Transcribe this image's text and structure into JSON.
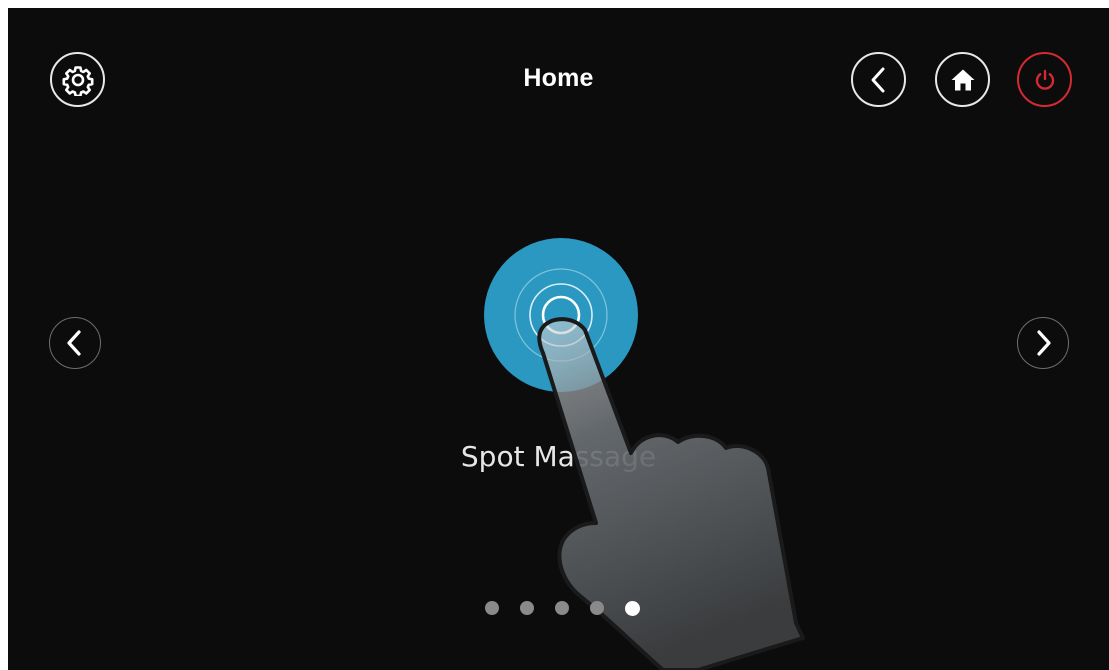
{
  "header": {
    "title": "Home",
    "settings_icon": "gear-icon",
    "back_icon": "chevron-left-icon",
    "home_icon": "home-icon",
    "power_icon": "power-icon"
  },
  "carousel": {
    "prev_icon": "chevron-left-icon",
    "next_icon": "chevron-right-icon",
    "feature": {
      "label": "Spot Massage",
      "icon": "ripple-target-icon",
      "color": "#2a98c0"
    },
    "page_count": 5,
    "active_page": 5
  },
  "overlay": {
    "icon": "tap-hand-icon"
  },
  "colors": {
    "background": "#0c0c0c",
    "power_accent": "#d42a31",
    "feature_accent": "#2a98c0"
  }
}
